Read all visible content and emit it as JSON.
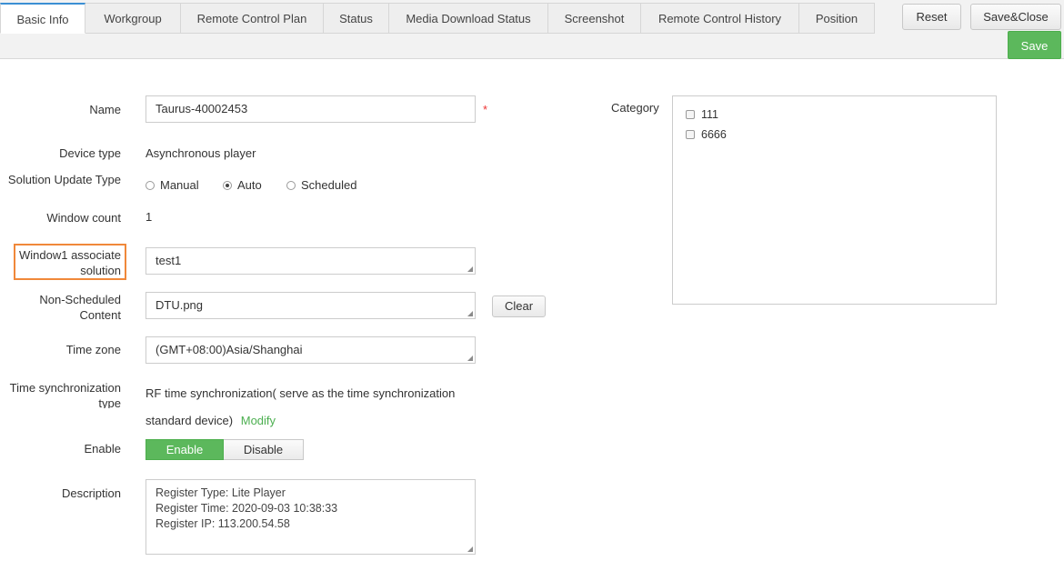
{
  "tabs": [
    {
      "label": "Basic Info",
      "active": true
    },
    {
      "label": "Workgroup"
    },
    {
      "label": "Remote Control Plan"
    },
    {
      "label": "Status"
    },
    {
      "label": "Media Download Status"
    },
    {
      "label": "Screenshot"
    },
    {
      "label": "Remote Control History"
    },
    {
      "label": "Position"
    }
  ],
  "toolbar": {
    "reset_label": "Reset",
    "save_close_label": "Save&Close",
    "save_label": "Save"
  },
  "form": {
    "name_label": "Name",
    "name_value": "Taurus-40002453",
    "required_mark": "*",
    "device_type_label": "Device type",
    "device_type_value": "Asynchronous player",
    "update_type_label": "Solution Update Type",
    "update_options": [
      "Manual",
      "Auto",
      "Scheduled"
    ],
    "update_selected": "Auto",
    "window_count_label": "Window count",
    "window_count_value": "1",
    "window1_label": "Window1 associate solution",
    "window1_value": "test1",
    "non_scheduled_label": "Non-Scheduled Content",
    "non_scheduled_value": "DTU.png",
    "clear_label": "Clear",
    "timezone_label": "Time zone",
    "timezone_value": "(GMT+08:00)Asia/Shanghai",
    "sync_label": "Time synchronization type",
    "sync_value_line1": "RF time synchronization( serve as the time synchronization",
    "sync_value_line2": "standard device)",
    "modify_label": "Modify",
    "enable_label": "Enable",
    "enable_on": "Enable",
    "enable_off": "Disable",
    "enable_selected": "Enable",
    "description_label": "Description",
    "description_lines": [
      "Register Type: Lite Player",
      "Register Time: 2020-09-03 10:38:33",
      "Register IP: 113.200.54.58"
    ]
  },
  "category": {
    "label": "Category",
    "items": [
      {
        "label": "111",
        "checked": false
      },
      {
        "label": "6666",
        "checked": false
      }
    ]
  },
  "colors": {
    "accent_green": "#5cb85c",
    "highlight_orange": "#f0883a",
    "required_red": "#ee3333"
  }
}
